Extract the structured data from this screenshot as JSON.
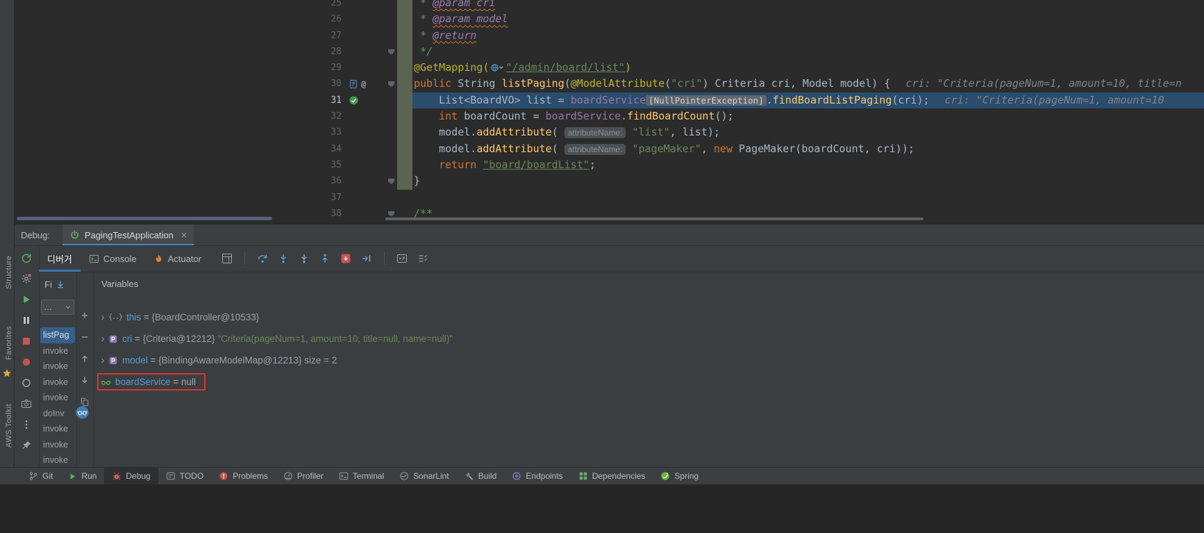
{
  "editor": {
    "lines": [
      {
        "num": "25",
        "strip": true,
        "tokens": [
          [
            "doc",
            " * "
          ],
          [
            "docerr",
            "@param cri"
          ]
        ]
      },
      {
        "num": "26",
        "strip": true,
        "tokens": [
          [
            "doc",
            " * "
          ],
          [
            "docerr",
            "@param model"
          ]
        ]
      },
      {
        "num": "27",
        "strip": true,
        "tokens": [
          [
            "doc",
            " * "
          ],
          [
            "docerr",
            "@return"
          ]
        ]
      },
      {
        "num": "28",
        "strip": true,
        "fold": true,
        "tokens": [
          [
            "doc",
            " */"
          ]
        ]
      },
      {
        "num": "29",
        "strip": true,
        "tokens": [
          [
            "ann",
            "@GetMapping("
          ],
          [
            "icon",
            "url-mapping-icon"
          ],
          [
            "strlink",
            "\"/admin/board/list\""
          ],
          [
            "ann",
            ")"
          ]
        ]
      },
      {
        "num": "30",
        "strip": true,
        "fold": true,
        "gutter": [
          "doc-marker-icon",
          "at-icon"
        ],
        "tokens": [
          [
            "kw",
            "public"
          ],
          [
            "plain",
            " String "
          ],
          [
            "mth",
            "listPaging"
          ],
          [
            "plain",
            "("
          ],
          [
            "ann",
            "@ModelAttribute"
          ],
          [
            "plain",
            "("
          ],
          [
            "str",
            "\"cri\""
          ],
          [
            "plain",
            ") Criteria cri, Model model) {"
          ],
          [
            "dbg",
            "cri: \"Criteria(pageNum=1, amount=10, title=n"
          ]
        ]
      },
      {
        "num": "31",
        "strip": true,
        "exec": true,
        "gutter": [
          "check-icon"
        ],
        "tokens": [
          [
            "plain",
            "    List<BoardVO> list = "
          ],
          [
            "fld",
            "boardService"
          ],
          [
            "chip",
            "[NullPointerException]"
          ],
          [
            "plain",
            "."
          ],
          [
            "mth",
            "findBoardListPaging"
          ],
          [
            "plain",
            "(cri);"
          ],
          [
            "dbg",
            "cri: \"Criteria(pageNum=1, amount=10"
          ]
        ]
      },
      {
        "num": "32",
        "strip": true,
        "tokens": [
          [
            "plain",
            "    "
          ],
          [
            "kw",
            "int"
          ],
          [
            "plain",
            " boardCount = "
          ],
          [
            "fld",
            "boardService"
          ],
          [
            "plain",
            "."
          ],
          [
            "mth",
            "findBoardCount"
          ],
          [
            "plain",
            "();"
          ]
        ]
      },
      {
        "num": "33",
        "strip": true,
        "tokens": [
          [
            "plain",
            "    model."
          ],
          [
            "mth",
            "addAttribute"
          ],
          [
            "plain",
            "( "
          ],
          [
            "hint",
            "attributeName:"
          ],
          [
            "plain",
            " "
          ],
          [
            "str",
            "\"list\""
          ],
          [
            "plain",
            ", list);"
          ]
        ]
      },
      {
        "num": "34",
        "strip": true,
        "tokens": [
          [
            "plain",
            "    model."
          ],
          [
            "mth",
            "addAttribute"
          ],
          [
            "plain",
            "( "
          ],
          [
            "hint",
            "attributeName:"
          ],
          [
            "plain",
            " "
          ],
          [
            "str",
            "\"pageMaker\""
          ],
          [
            "plain",
            ", "
          ],
          [
            "kw",
            "new"
          ],
          [
            "plain",
            " PageMaker(boardCount, cri));"
          ]
        ]
      },
      {
        "num": "35",
        "strip": true,
        "tokens": [
          [
            "plain",
            "    "
          ],
          [
            "kw",
            "return"
          ],
          [
            "plain",
            " "
          ],
          [
            "strlink",
            "\"board/boardList\""
          ],
          [
            "plain",
            ";"
          ]
        ]
      },
      {
        "num": "36",
        "strip": true,
        "fold": true,
        "tokens": [
          [
            "plain",
            "}"
          ]
        ]
      },
      {
        "num": "37",
        "tokens": []
      },
      {
        "num": "38",
        "fold": true,
        "tokens": [
          [
            "doc",
            "/**"
          ]
        ]
      }
    ]
  },
  "debug": {
    "label": "Debug:",
    "session_tab": {
      "icon": "run-config-icon",
      "title": "PagingTestApplication",
      "close": "×"
    },
    "tabs": [
      {
        "label": "디버거",
        "selected": true
      },
      {
        "label": "Console",
        "icon": "console-icon"
      },
      {
        "label": "Actuator",
        "icon": "actuator-flame-icon"
      }
    ],
    "toolbar_groups": [
      [
        "restore-layout-icon"
      ],
      [
        "step-over-icon",
        "step-into-icon",
        "force-step-into-icon",
        "step-out-icon",
        "drop-frame-icon",
        "run-to-cursor-icon"
      ],
      [
        "evaluate-expression-icon",
        "view-options-icon"
      ]
    ],
    "left_toolbar_icons": [
      "rerun-icon",
      "settings-icon",
      "resume-icon",
      "pause-icon",
      "stop-icon",
      "view-breakpoints-icon",
      "mute-breakpoints-icon",
      "thread-dump-icon",
      "more-icon",
      "pin-icon"
    ],
    "frames": {
      "header": "Fi",
      "dropdown": "…",
      "items": [
        {
          "label": "listPag",
          "selected": true
        },
        {
          "label": "invoke"
        },
        {
          "label": "invoke"
        },
        {
          "label": "invoke"
        },
        {
          "label": "invoke"
        },
        {
          "label": "doInv"
        },
        {
          "label": "invoke"
        },
        {
          "label": "invoke"
        },
        {
          "label": "invoke"
        }
      ]
    },
    "watch_toolbar_icons": [
      "plus-icon",
      "minus-icon",
      "up-icon",
      "down-icon",
      "copy-icon"
    ],
    "variables": {
      "tab": "Variables",
      "rows": [
        {
          "expander": true,
          "icon": "braces-icon",
          "name": "this",
          "value": "{BoardController@10533}"
        },
        {
          "expander": true,
          "icon": "parameter-icon",
          "name": "cri",
          "value": "{Criteria@12212}",
          "string": "\"Criteria(pageNum=1, amount=10, title=null, name=null)\""
        },
        {
          "expander": true,
          "icon": "parameter-icon",
          "name": "model",
          "value": "{BindingAwareModelMap@12213}",
          "extra": "size = 2"
        },
        {
          "expander": false,
          "icon": "watch-icon",
          "name": "boardService",
          "value": "null",
          "highlighted": true
        }
      ]
    }
  },
  "statusbar": {
    "items": [
      {
        "label": "Git",
        "icon": "git-branch-icon"
      },
      {
        "label": "Run",
        "icon": "run-icon"
      },
      {
        "label": "Debug",
        "icon": "debug-bug-icon",
        "selected": true
      },
      {
        "label": "TODO",
        "icon": "todo-icon"
      },
      {
        "label": "Problems",
        "icon": "problems-icon"
      },
      {
        "label": "Profiler",
        "icon": "profiler-icon"
      },
      {
        "label": "Terminal",
        "icon": "terminal-icon"
      },
      {
        "label": "SonarLint",
        "icon": "sonarlint-icon"
      },
      {
        "label": "Build",
        "icon": "build-icon"
      },
      {
        "label": "Endpoints",
        "icon": "endpoints-icon"
      },
      {
        "label": "Dependencies",
        "icon": "dependencies-icon"
      },
      {
        "label": "Spring",
        "icon": "spring-icon"
      }
    ]
  },
  "left_stripe": {
    "items": [
      {
        "label": "Structure"
      },
      {
        "label": "Favorites",
        "icon": "star-icon"
      },
      {
        "label": "AWS Toolkit"
      }
    ]
  }
}
